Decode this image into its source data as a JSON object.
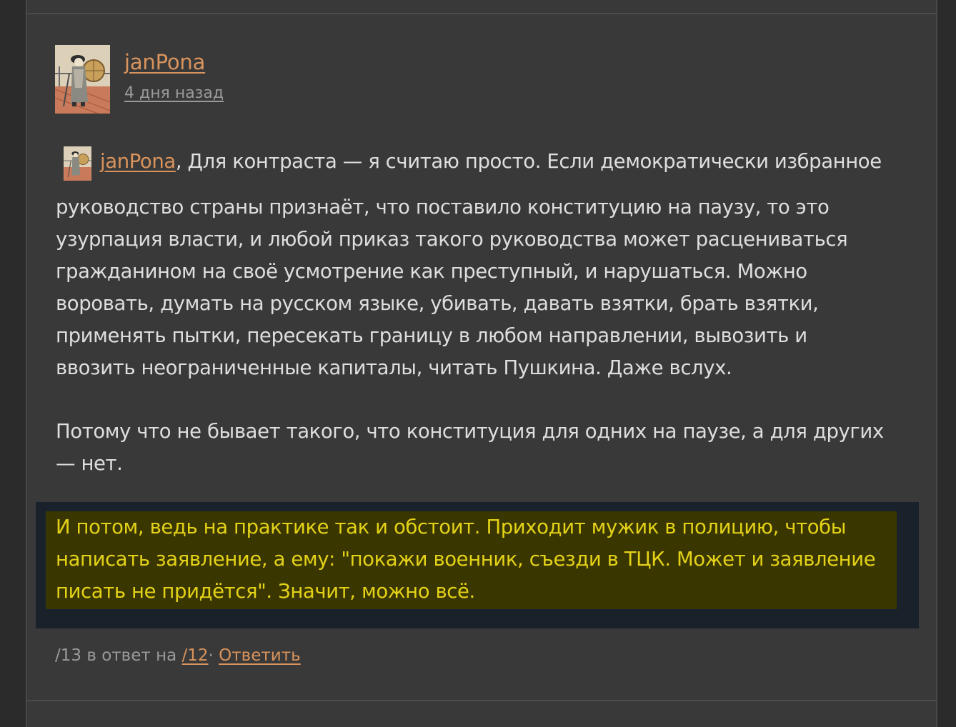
{
  "comment": {
    "author": "janPona",
    "date": "4 дня назад",
    "mention": "janPona",
    "first_line_rest": ", Для контраста — я считаю просто. Если демократически избранное",
    "paragraph1_lines": [
      "руководство страны признаёт, что поставило конституцию на паузу, то это",
      "узурпация власти, и любой приказ такого руководства может расцениваться",
      "гражданином на своё усмотрение как преступный, и нарушаться. Можно",
      "воровать, думать на русском языке, убивать, давать взятки, брать взятки,",
      "применять пытки, пересекать границу в любом направлении, вывозить и",
      "ввозить неограниченные капиталы, читать Пушкина. Даже вслух."
    ],
    "paragraph2_lines": [
      "Потому что не бывает такого, что конституция для одних на паузе, а для других",
      "— нет."
    ],
    "highlight_lines": [
      "И потом, ведь на практике так и обстоит. Приходит мужик в полицию, чтобы",
      "написать заявление, а ему: \"покажи военник, съезди в ТЦК. Может и заявление",
      "писать не придётся\". Значит, можно всё."
    ]
  },
  "footer": {
    "number": "/13",
    "reply_to_text": "в ответ на",
    "reply_to_link": "/12",
    "separator": "·",
    "reply_button": "Ответить"
  },
  "colors": {
    "link": "#d9935c",
    "highlight_text": "#e3d218",
    "highlight_bg": "#3a3600",
    "panel_bg": "#393939"
  }
}
